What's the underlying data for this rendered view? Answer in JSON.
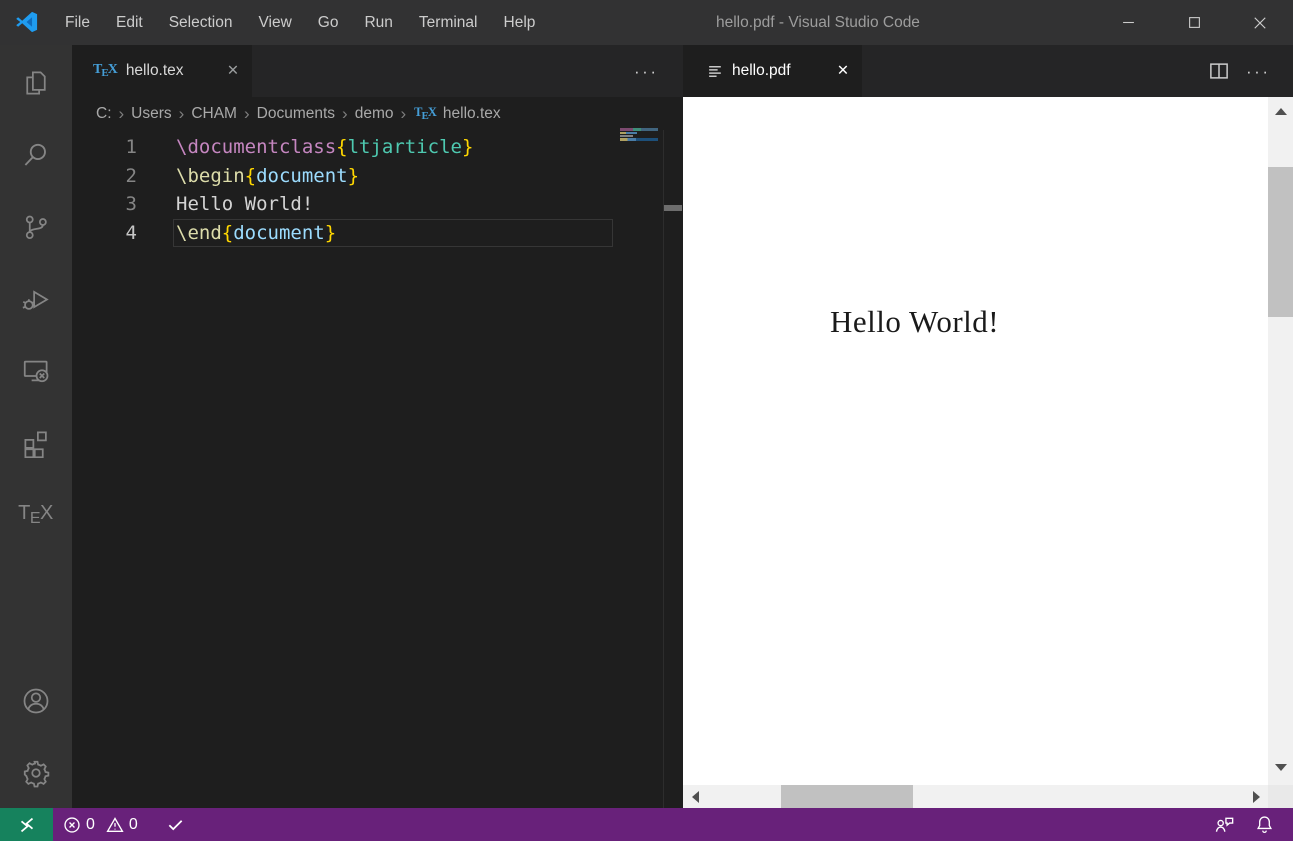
{
  "colors": {
    "title_bar_bg": "#323233",
    "title_fg": "#9d9d9d",
    "menu_fg": "#cccccc",
    "activity_bar_bg": "#333333",
    "activity_icon_fg": "#858585",
    "editor_bg": "#1e1e1e",
    "tab_bar_bg": "#252526",
    "tab_active_bg": "#1e1e1e",
    "tab_active_fg": "#ffffff",
    "breadcrumb_fg": "#a9a9a9",
    "status_bar_bg": "#68217a",
    "remote_bg": "#16825d",
    "status_fg": "#ffffff",
    "pdf_bg": "#ffffff",
    "pdf_text_fg": "#1a1a1a",
    "scrollbar_track": "#f1f1f1",
    "scrollbar_thumb": "#c1c1c1",
    "scrollbar_arrow": "#505050",
    "tex_icon_blue": "#459ed7",
    "syntax": {
      "keyword": "#C586C0",
      "function": "#DCDCAA",
      "brace": "#FFD700",
      "class_name": "#4EC9B0",
      "param": "#9CDCFE",
      "plain": "#D4D4D4",
      "line_number": "#858585",
      "line_number_active": "#C6C6C6"
    }
  },
  "glyphs": {
    "close": "✕",
    "more": "···",
    "breadcrumb_separator": "›"
  },
  "title_bar": {
    "menus": [
      "File",
      "Edit",
      "Selection",
      "View",
      "Go",
      "Run",
      "Terminal",
      "Help"
    ],
    "title": "hello.pdf - Visual Studio Code"
  },
  "activity_bar": {
    "items": [
      {
        "icon": "files",
        "name": "explorer"
      },
      {
        "icon": "search",
        "name": "search"
      },
      {
        "icon": "source-control",
        "name": "source-control"
      },
      {
        "icon": "debug",
        "name": "run-and-debug"
      },
      {
        "icon": "remote-explorer",
        "name": "remote-explorer"
      },
      {
        "icon": "extensions",
        "name": "extensions"
      },
      {
        "icon": "tex",
        "name": "latex-workshop",
        "label": "TEX"
      }
    ],
    "bottom": [
      {
        "icon": "account",
        "name": "accounts"
      },
      {
        "icon": "gear",
        "name": "manage"
      }
    ]
  },
  "left_group": {
    "tab": {
      "label": "hello.tex"
    },
    "breadcrumb": [
      "C:",
      "Users",
      "CHAM",
      "Documents",
      "demo",
      "hello.tex"
    ],
    "code": {
      "lines": [
        {
          "number": "1",
          "tokens": [
            {
              "t": "\\documentclass",
              "c": "keyword"
            },
            {
              "t": "{",
              "c": "brace"
            },
            {
              "t": "ltjarticle",
              "c": "class_name"
            },
            {
              "t": "}",
              "c": "brace"
            }
          ]
        },
        {
          "number": "2",
          "tokens": [
            {
              "t": "\\begin",
              "c": "function"
            },
            {
              "t": "{",
              "c": "brace"
            },
            {
              "t": "document",
              "c": "param"
            },
            {
              "t": "}",
              "c": "brace"
            }
          ]
        },
        {
          "number": "3",
          "tokens": [
            {
              "t": "Hello World!",
              "c": "plain"
            }
          ]
        },
        {
          "number": "4",
          "current": true,
          "tokens": [
            {
              "t": "\\end",
              "c": "function"
            },
            {
              "t": "{",
              "c": "brace"
            },
            {
              "t": "document",
              "c": "param"
            },
            {
              "t": "}",
              "c": "brace"
            }
          ]
        }
      ]
    }
  },
  "right_group": {
    "tab": {
      "label": "hello.pdf"
    },
    "pdf": {
      "text": "Hello World!"
    }
  },
  "status_bar": {
    "errors": "0",
    "warnings": "0"
  }
}
